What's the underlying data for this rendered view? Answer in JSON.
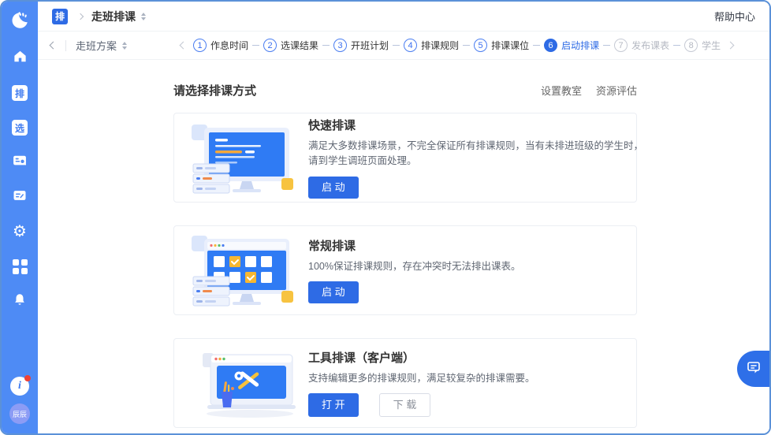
{
  "topbar": {
    "module_badge": "排",
    "title": "走班排课",
    "help_center": "帮助中心"
  },
  "subbar": {
    "plan_label": "走班方案",
    "steps": [
      {
        "num": "1",
        "label": "作息时间"
      },
      {
        "num": "2",
        "label": "选课结果"
      },
      {
        "num": "3",
        "label": "开班计划"
      },
      {
        "num": "4",
        "label": "排课规则"
      },
      {
        "num": "5",
        "label": "排课课位"
      },
      {
        "num": "6",
        "label": "启动排课"
      },
      {
        "num": "7",
        "label": "发布课表"
      },
      {
        "num": "8",
        "label": "学生"
      }
    ]
  },
  "main": {
    "heading": "请选择排课方式",
    "links": [
      "设置教室",
      "资源评估"
    ],
    "cards": [
      {
        "title": "快速排课",
        "desc": "满足大多数排课场景，不完全保证所有排课规则，当有未排进班级的学生时，请到学生调班页面处理。",
        "primary": "启 动"
      },
      {
        "title": "常规排课",
        "desc": "100%保证排课规则，存在冲突时无法排出课表。",
        "primary": "启 动"
      },
      {
        "title": "工具排课（客户端）",
        "desc": "支持编辑更多的排课规则，满足较复杂的排课需要。",
        "primary": "打 开",
        "secondary": "下 载"
      }
    ]
  },
  "sidebar": {
    "badge_schedule": "排",
    "badge_select": "选",
    "avatar_label": "辰辰"
  },
  "colors": {
    "accent": "#2e6be5",
    "sidebar_blue": "#4e8bf5",
    "window_border": "#5b91d8",
    "step_future": "#b4b8c2"
  }
}
